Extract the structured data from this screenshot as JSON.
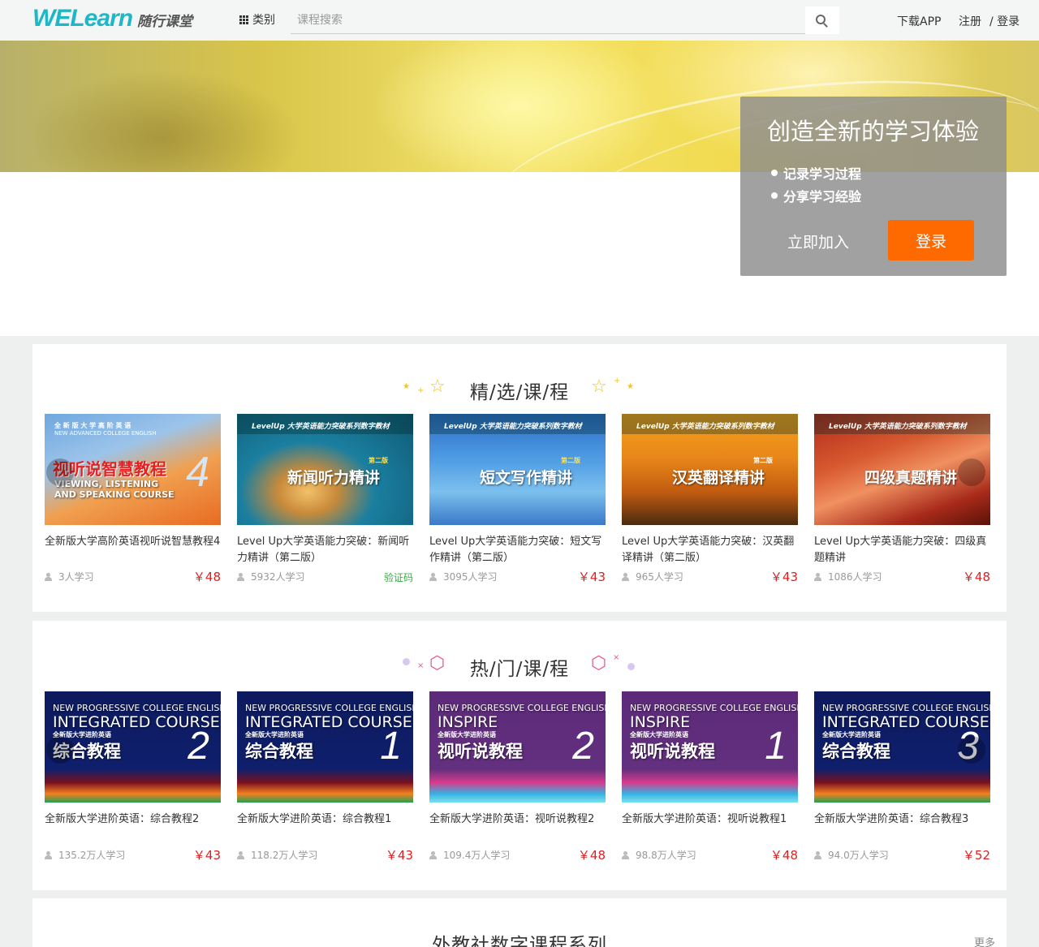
{
  "header": {
    "logo_main": "WELearn",
    "logo_sub": "随行课堂",
    "category_label": "类别",
    "search_placeholder": "课程搜索",
    "download_app": "下载APP",
    "register": "注册",
    "login": "/ 登录"
  },
  "promo": {
    "title": "创造全新的学习体验",
    "items": [
      "记录学习过程",
      "分享学习经验"
    ],
    "join_label": "立即加入",
    "login_label": "登录"
  },
  "featured": {
    "title": "精/选/课/程",
    "courses": [
      {
        "cover_top": "全 新 版 大 学 高 阶 英 语",
        "cover_sub": "NEW ADVANCED COLLEGE ENGLISH",
        "cover_title": "视听说智慧教程",
        "cover_en1": "VIEWING, LISTENING",
        "cover_en2": "AND SPEAKING COURSE",
        "cover_num": "4",
        "title": "全新版大学高阶英语视听说智慧教程4",
        "learners": "3人学习",
        "price": "￥48"
      },
      {
        "series": "LevelUp 大学英语能力突破系列数字教材",
        "cover_title": "新闻听力精讲",
        "edition": "第二版",
        "title": "Level Up大学英语能力突破：新闻听力精讲（第二版）",
        "learners": "5932人学习",
        "price": "验证码"
      },
      {
        "series": "LevelUp 大学英语能力突破系列数字教材",
        "cover_title": "短文写作精讲",
        "edition": "第二版",
        "title": "Level Up大学英语能力突破：短文写作精讲（第二版）",
        "learners": "3095人学习",
        "price": "￥43"
      },
      {
        "series": "LevelUp 大学英语能力突破系列数字教材",
        "cover_title": "汉英翻译精讲",
        "edition": "第二版",
        "title": "Level Up大学英语能力突破：汉英翻译精讲（第二版）",
        "learners": "965人学习",
        "price": "￥43"
      },
      {
        "series": "LevelUp 大学英语能力突破系列数字教材",
        "cover_title": "四级真题精讲",
        "edition": "",
        "title": "Level Up大学英语能力突破：四级真题精讲",
        "learners": "1086人学习",
        "price": "￥48"
      }
    ]
  },
  "hot": {
    "title": "热/门/课/程",
    "courses": [
      {
        "cover_en": "NEW PROGRESSIVE COLLEGE ENGLISH",
        "cover_en2": "INTEGRATED COURSE",
        "cover_series": "全新版大学进阶英语",
        "cover_title": "综合教程",
        "cover_num": "2",
        "title": "全新版大学进阶英语：综合教程2",
        "learners": "135.2万人学习",
        "price": "￥43"
      },
      {
        "cover_en": "NEW PROGRESSIVE COLLEGE ENGLISH",
        "cover_en2": "INTEGRATED COURSE",
        "cover_series": "全新版大学进阶英语",
        "cover_title": "综合教程",
        "cover_num": "1",
        "title": "全新版大学进阶英语：综合教程1",
        "learners": "118.2万人学习",
        "price": "￥43"
      },
      {
        "cover_en": "NEW PROGRESSIVE COLLEGE ENGLISH",
        "cover_en2": "INSPIRE",
        "cover_series": "全新版大学进阶英语",
        "cover_title": "视听说教程",
        "cover_num": "2",
        "title": "全新版大学进阶英语：视听说教程2",
        "learners": "109.4万人学习",
        "price": "￥48"
      },
      {
        "cover_en": "NEW PROGRESSIVE COLLEGE ENGLISH",
        "cover_en2": "INSPIRE",
        "cover_series": "全新版大学进阶英语",
        "cover_title": "视听说教程",
        "cover_num": "1",
        "title": "全新版大学进阶英语：视听说教程1",
        "learners": "98.8万人学习",
        "price": "￥48"
      },
      {
        "cover_en": "NEW PROGRESSIVE COLLEGE ENGLISH",
        "cover_en2": "INTEGRATED COURSE",
        "cover_series": "全新版大学进阶英语",
        "cover_title": "综合教程",
        "cover_num": "3",
        "title": "全新版大学进阶英语：综合教程3",
        "learners": "94.0万人学习",
        "price": "￥52"
      }
    ]
  },
  "foreign": {
    "title": "外教社数字课程系列",
    "more": "更多"
  }
}
